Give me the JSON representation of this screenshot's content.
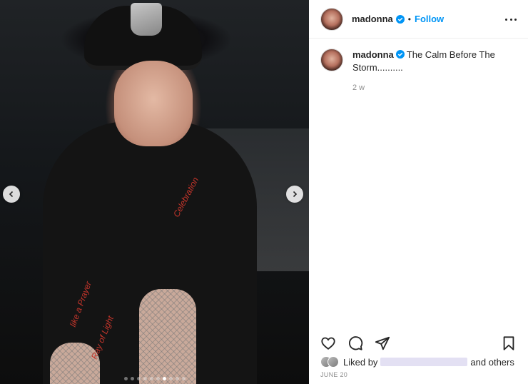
{
  "post": {
    "username": "madonna",
    "follow_label": "Follow",
    "separator": "•",
    "caption_text": "The Calm Before The Storm..........",
    "timestamp": "2 w",
    "likes_prefix": "Liked by",
    "likes_suffix": "and others",
    "date": "JUNE 20"
  },
  "media": {
    "slide_count": 10,
    "active_slide": 7,
    "red_texts": [
      "like a Prayer",
      "Ray of Light",
      "Celebration"
    ]
  },
  "icons": {
    "verified": "verified-badge-icon",
    "more": "more-options-icon",
    "like": "heart-icon",
    "comment": "comment-bubble-icon",
    "share": "paper-plane-icon",
    "save": "bookmark-icon",
    "prev": "chevron-left-icon",
    "next": "chevron-right-icon"
  },
  "colors": {
    "accent": "#0095f6",
    "text": "#262626",
    "muted": "#8e8e8e"
  }
}
